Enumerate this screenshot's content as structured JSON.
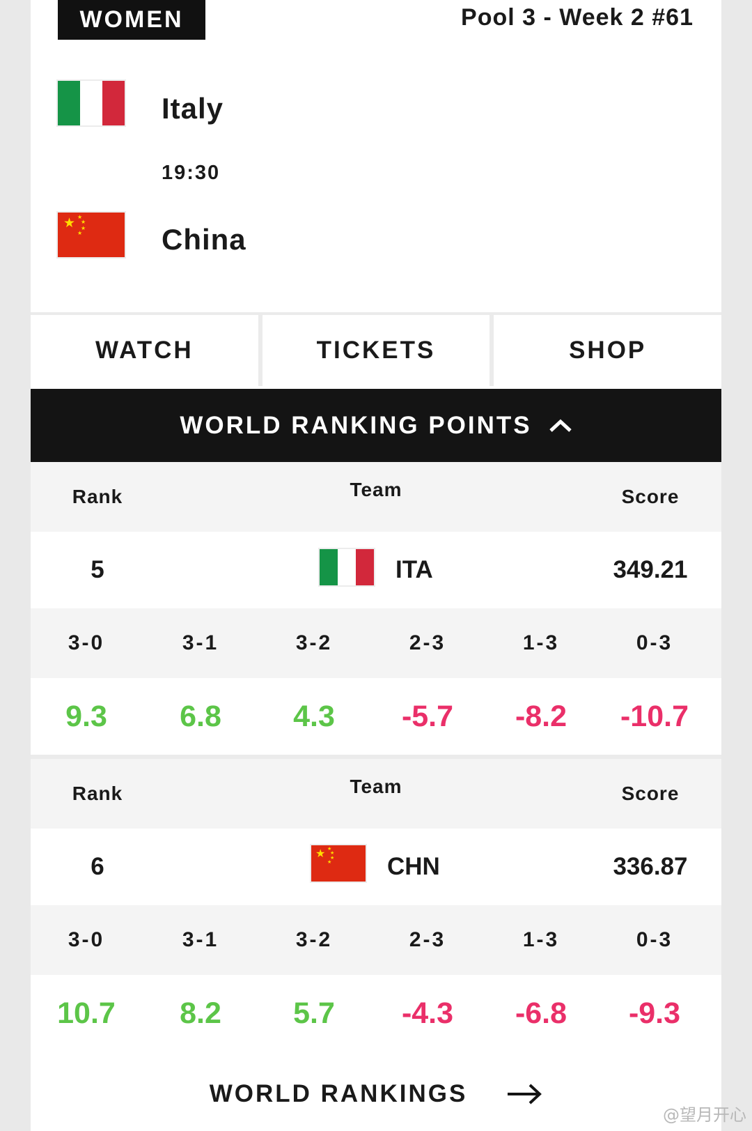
{
  "match": {
    "category": "WOMEN",
    "pool_label": "Pool 3 - Week 2 #61",
    "time": "19:30",
    "home": {
      "name": "Italy"
    },
    "away": {
      "name": "China"
    }
  },
  "actions": {
    "watch": "WATCH",
    "tickets": "TICKETS",
    "shop": "SHOP"
  },
  "ranking_section": {
    "title": "WORLD RANKING POINTS"
  },
  "teams": [
    {
      "headers": {
        "rank": "Rank",
        "team": "Team",
        "score": "Score"
      },
      "rank": "5",
      "code": "ITA",
      "score": "349.21",
      "results": [
        {
          "label": "3-0",
          "points": "9.3"
        },
        {
          "label": "3-1",
          "points": "6.8"
        },
        {
          "label": "3-2",
          "points": "4.3"
        },
        {
          "label": "2-3",
          "points": "-5.7"
        },
        {
          "label": "1-3",
          "points": "-8.2"
        },
        {
          "label": "0-3",
          "points": "-10.7"
        }
      ]
    },
    {
      "headers": {
        "rank": "Rank",
        "team": "Team",
        "score": "Score"
      },
      "rank": "6",
      "code": "CHN",
      "score": "336.87",
      "results": [
        {
          "label": "3-0",
          "points": "10.7"
        },
        {
          "label": "3-1",
          "points": "8.2"
        },
        {
          "label": "3-2",
          "points": "5.7"
        },
        {
          "label": "2-3",
          "points": "-4.3"
        },
        {
          "label": "1-3",
          "points": "-6.8"
        },
        {
          "label": "0-3",
          "points": "-9.3"
        }
      ]
    }
  ],
  "footer": {
    "world_rankings": "WORLD RANKINGS"
  },
  "watermark": "@望月开心",
  "colors": {
    "positive": "#5cc548",
    "negative": "#ea2f69",
    "dark": "#141414"
  }
}
